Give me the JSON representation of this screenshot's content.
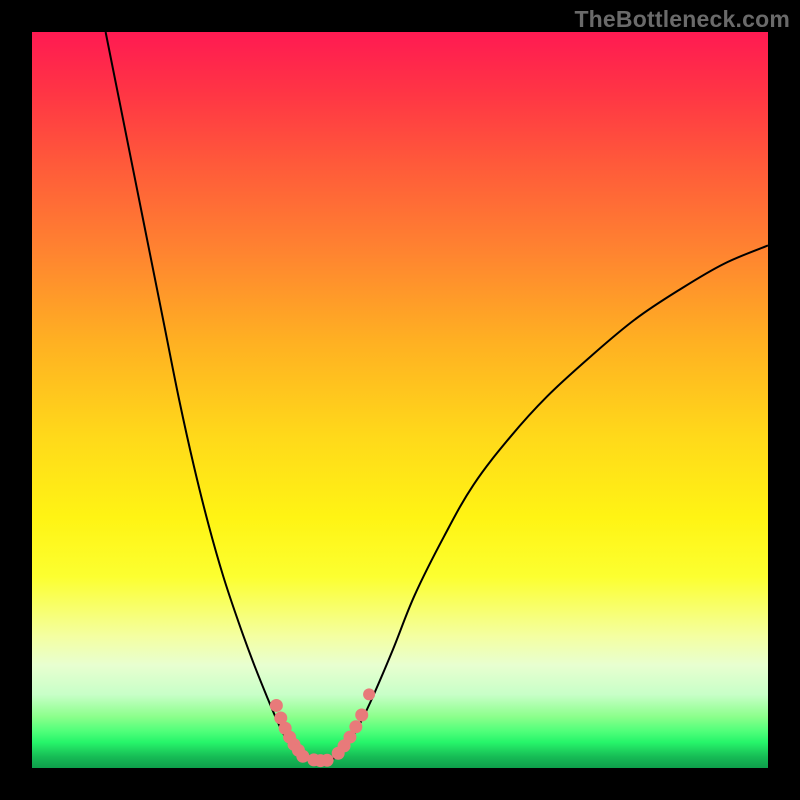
{
  "watermark": "TheBottleneck.com",
  "chart_data": {
    "type": "line",
    "title": "",
    "xlabel": "",
    "ylabel": "",
    "xlim": [
      0,
      100
    ],
    "ylim": [
      0,
      100
    ],
    "grid": false,
    "series": [
      {
        "name": "left-curve",
        "x": [
          10,
          12,
          14,
          16,
          18,
          20,
          22,
          24,
          26,
          28,
          30,
          32,
          33.5,
          34.8,
          36
        ],
        "y": [
          100,
          90,
          80,
          70,
          60,
          50,
          41,
          33,
          26,
          20,
          14.5,
          9.5,
          6,
          3.5,
          2
        ]
      },
      {
        "name": "valley-floor",
        "x": [
          36,
          37,
          38,
          39,
          40,
          41,
          42
        ],
        "y": [
          2,
          1.4,
          1.1,
          1.0,
          1.05,
          1.3,
          2
        ]
      },
      {
        "name": "right-curve",
        "x": [
          42,
          44,
          46,
          49,
          52,
          56,
          60,
          65,
          70,
          76,
          82,
          88,
          94,
          100
        ],
        "y": [
          2,
          5,
          9,
          16,
          23.5,
          31.5,
          38.5,
          45,
          50.5,
          56,
          61,
          65,
          68.5,
          71
        ]
      }
    ],
    "markers": [
      {
        "name": "cluster-left",
        "x": [
          33.2,
          33.8,
          34.4,
          35.0,
          35.6,
          36.2
        ],
        "y": [
          8.5,
          6.8,
          5.4,
          4.2,
          3.2,
          2.4
        ],
        "size": 13
      },
      {
        "name": "cluster-floor-left",
        "x": [
          36.8
        ],
        "y": [
          1.6
        ],
        "size": 13
      },
      {
        "name": "cluster-floor-mid",
        "x": [
          38.3,
          39.2,
          40.1
        ],
        "y": [
          1.1,
          1.0,
          1.05
        ],
        "size": 13
      },
      {
        "name": "cluster-right",
        "x": [
          41.6,
          42.4,
          43.2,
          44.0,
          44.8
        ],
        "y": [
          2.0,
          3.0,
          4.2,
          5.6,
          7.2
        ],
        "size": 13
      },
      {
        "name": "dot-high-right",
        "x": [
          45.8
        ],
        "y": [
          10.0
        ],
        "size": 12
      }
    ]
  }
}
